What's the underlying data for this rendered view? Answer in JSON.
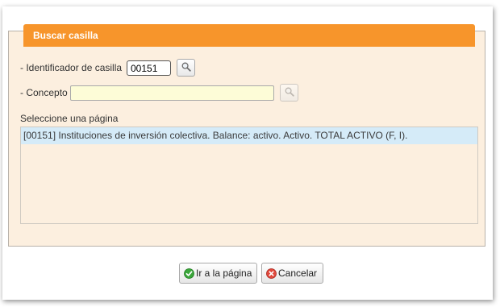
{
  "dialog": {
    "title": "Buscar casilla",
    "identifier_label": "- Identificador de casilla",
    "identifier_value": "00151",
    "concept_label": "- Concepto",
    "concept_value": "",
    "select_page_label": "Seleccione una página",
    "results": [
      {
        "text": "[00151] Instituciones de inversión colectiva. Balance: activo. Activo. TOTAL ACTIVO (F, I).",
        "selected": true
      }
    ]
  },
  "buttons": {
    "go_to_page": "Ir a la página",
    "cancel": "Cancelar"
  },
  "icons": {
    "search": "magnifier-icon",
    "ok": "check-circle-icon",
    "cancel": "cancel-circle-icon"
  },
  "colors": {
    "title_bar": "#f7952b",
    "panel_background": "#fcefdf",
    "selected_row": "#d5ebf8",
    "concept_field": "#fdfcd7"
  }
}
